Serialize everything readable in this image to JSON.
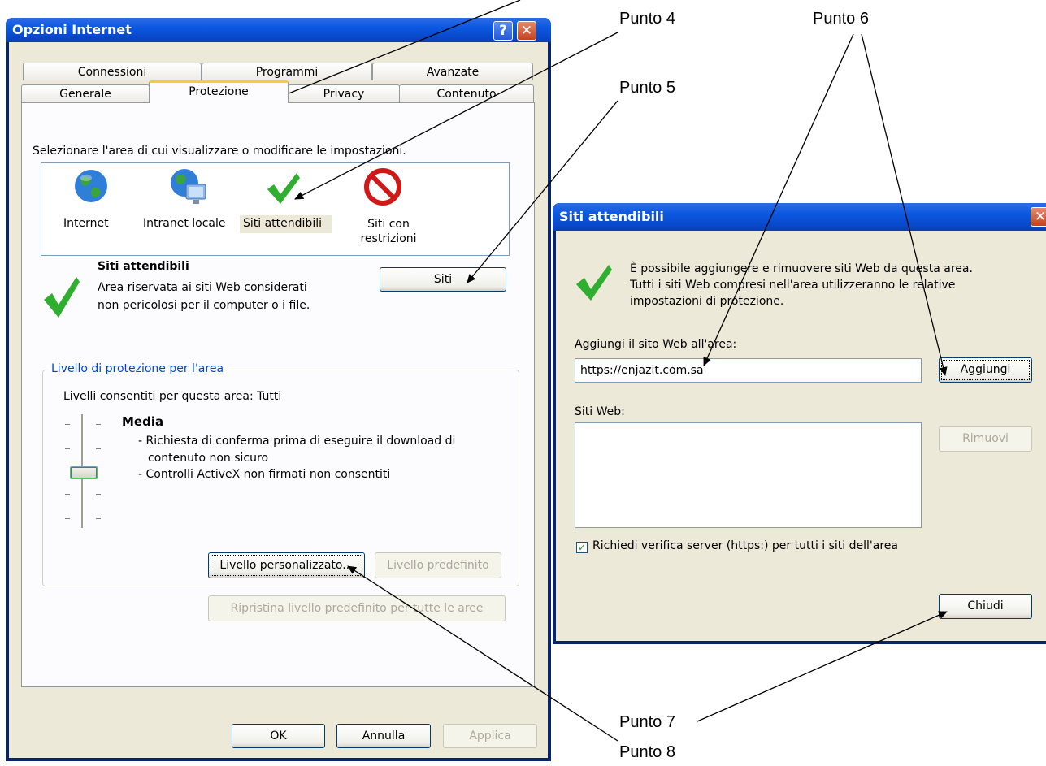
{
  "main_window": {
    "title": "Opzioni Internet",
    "help_btn": "?",
    "close_btn": "✕",
    "tabs_back": [
      "Connessioni",
      "Programmi",
      "Avanzate"
    ],
    "tabs_front": [
      "Generale",
      "Protezione",
      "Privacy",
      "Contenuto"
    ],
    "zone_prompt": "Selezionare l'area di cui visualizzare o modificare le impostazioni.",
    "zones": [
      {
        "label": "Internet",
        "icon": "globe-icon"
      },
      {
        "label": "Intranet locale",
        "icon": "intranet-globe-icon"
      },
      {
        "label": "Siti attendibili",
        "icon": "green-check-icon"
      },
      {
        "label": "Siti con restrizioni",
        "icon": "no-entry-icon"
      }
    ],
    "zone_title": "Siti attendibili",
    "zone_desc_1": "Area riservata ai siti Web considerati",
    "zone_desc_2": "non pericolosi per il computer o i file.",
    "siti_button": "Siti",
    "level_group": "Livello di protezione per l'area",
    "levels_allowed": "Livelli consentiti per questa area: Tutti",
    "level_name": "Media",
    "level_desc_1": "- Richiesta di conferma prima di eseguire il download di",
    "level_desc_2": "contenuto non sicuro",
    "level_desc_3": "- Controlli ActiveX non firmati non consentiti",
    "custom_button": "Livello personalizzato...",
    "default_button": "Livello predefinito",
    "reset_all_button": "Ripristina livello predefinito per tutte le aree",
    "ok_button": "OK",
    "cancel_button": "Annulla",
    "apply_button": "Applica"
  },
  "dialog": {
    "title": "Siti attendibili",
    "close_btn": "✕",
    "info_1": "È possibile aggiungere e rimuovere siti Web da questa area.",
    "info_2": "Tutti i siti Web compresi nell'area utilizzeranno le relative",
    "info_3": "impostazioni di protezione.",
    "add_label": "Aggiungi il sito Web all'area:",
    "url_value": "https://enjazit.com.sa",
    "add_button": "Aggiungi",
    "sites_label": "Siti Web:",
    "remove_button": "Rimuovi",
    "https_check": "Richiedi verifica server (https:) per tutti i siti dell'area",
    "close_button": "Chiudi"
  },
  "annotations": {
    "punto4": "Punto 4",
    "punto5": "Punto 5",
    "punto6": "Punto 6",
    "punto7": "Punto 7",
    "punto8": "Punto 8"
  }
}
